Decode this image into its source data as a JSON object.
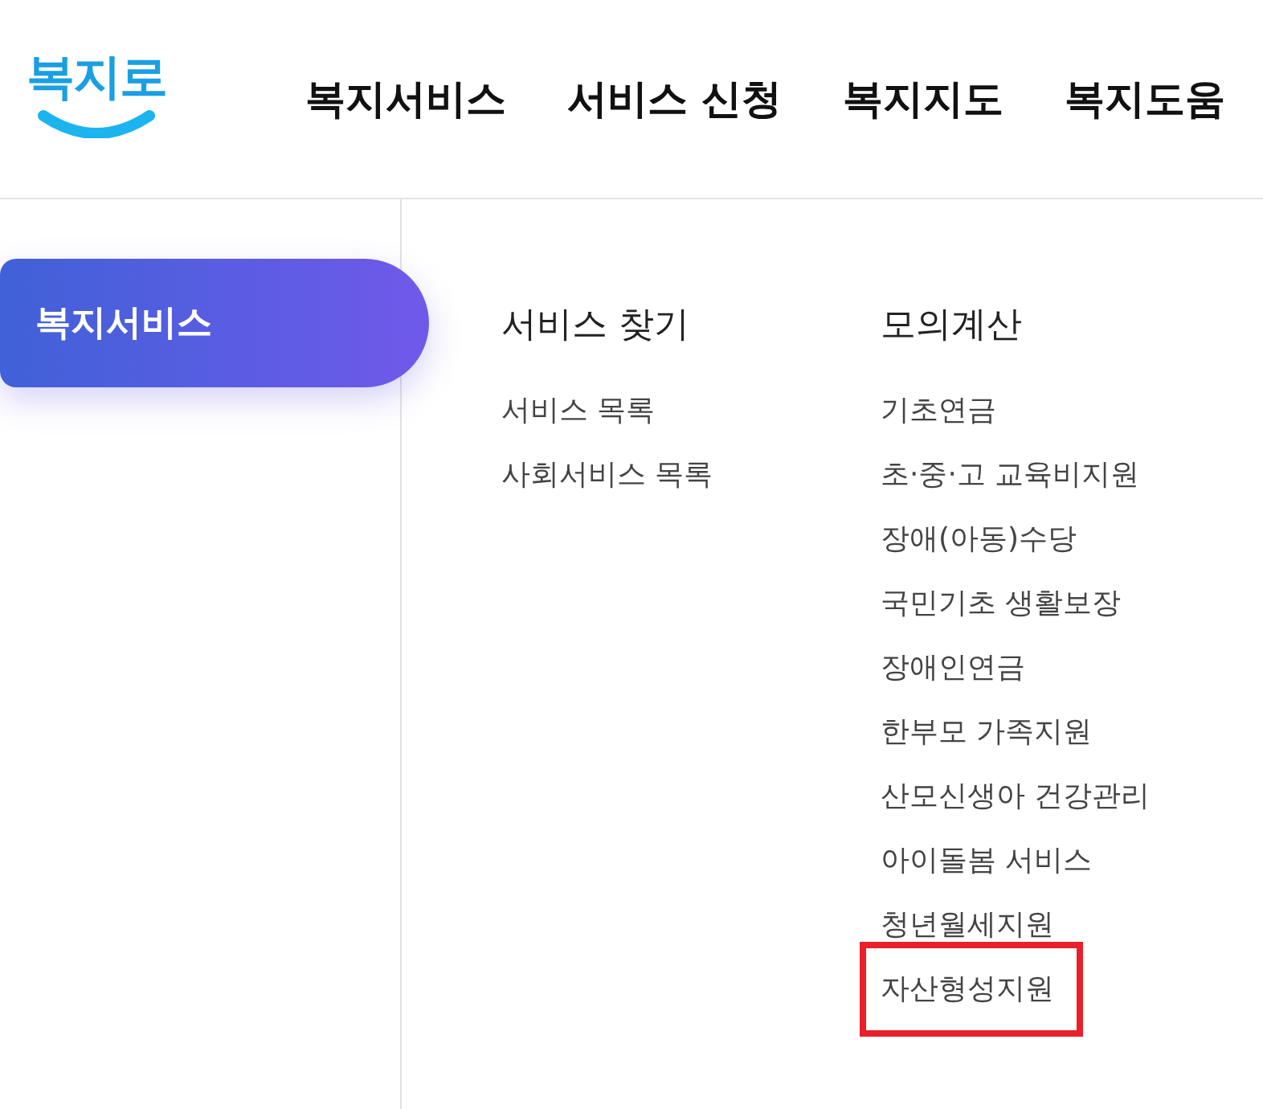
{
  "header": {
    "logo": "복지로",
    "nav": [
      {
        "label": "복지서비스"
      },
      {
        "label": "서비스 신청"
      },
      {
        "label": "복지지도"
      },
      {
        "label": "복지도움"
      }
    ]
  },
  "sidebar": {
    "items": [
      {
        "label": "복지서비스",
        "selected": true
      }
    ]
  },
  "menu": {
    "columns": [
      {
        "heading": "서비스 찾기",
        "items": [
          {
            "label": "서비스 목록",
            "highlighted": false
          },
          {
            "label": "사회서비스 목록",
            "highlighted": false
          }
        ]
      },
      {
        "heading": "모의계산",
        "items": [
          {
            "label": "기초연금",
            "highlighted": false
          },
          {
            "label": "초·중·고 교육비지원",
            "highlighted": false
          },
          {
            "label": "장애(아동)수당",
            "highlighted": false
          },
          {
            "label": "국민기초 생활보장",
            "highlighted": false
          },
          {
            "label": "장애인연금",
            "highlighted": false
          },
          {
            "label": "한부모 가족지원",
            "highlighted": false
          },
          {
            "label": "산모신생아 건강관리",
            "highlighted": false
          },
          {
            "label": "아이돌봄 서비스",
            "highlighted": false
          },
          {
            "label": "청년월세지원",
            "highlighted": false
          },
          {
            "label": "자산형성지원",
            "highlighted": true
          }
        ]
      }
    ]
  }
}
